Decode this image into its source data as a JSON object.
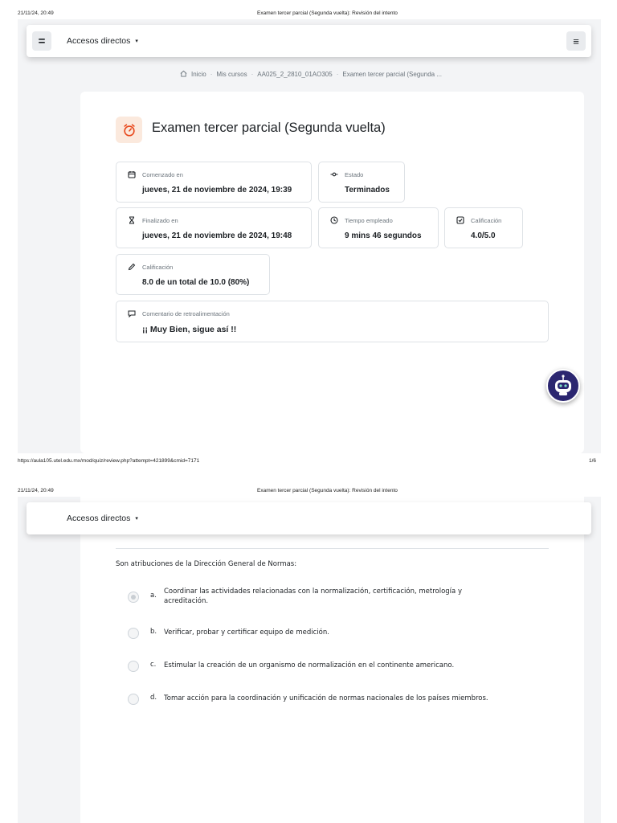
{
  "print": {
    "datetime": "21/11/24, 20:49",
    "doc_title": "Examen tercer parcial (Segunda vuelta): Revisión del intento",
    "url": "https://aula105.utel.edu.mx/mod/quiz/review.php?attempt=421899&cmid=7171",
    "page_num": "1/6"
  },
  "navbar": {
    "menu_glyph": "=",
    "label": "Accesos directos",
    "caret": "▾",
    "right_menu_glyph": "≡"
  },
  "breadcrumb": [
    {
      "label": "Inicio"
    },
    {
      "label": "Mis cursos"
    },
    {
      "label": "AA025_2_2810_01AO305"
    },
    {
      "label": "Examen tercer parcial (Segunda ..."
    }
  ],
  "breadcrumb_sep": "·",
  "page_title": "Examen tercer parcial (Segunda vuelta)",
  "info": {
    "started": {
      "label": "Comenzado en",
      "value": "jueves, 21 de noviembre de 2024, 19:39",
      "icon": "calendar-icon"
    },
    "state": {
      "label": "Estado",
      "value": "Terminados",
      "icon": "state-icon"
    },
    "finished": {
      "label": "Finalizado en",
      "value": "jueves, 21 de noviembre de 2024, 19:48",
      "icon": "hourglass-icon"
    },
    "time_taken": {
      "label": "Tiempo empleado",
      "value": "9 mins 46 segundos",
      "icon": "clock-icon"
    },
    "marks": {
      "label": "Calificación",
      "value": "4.0/5.0",
      "icon": "check-square-icon"
    },
    "grade": {
      "label": "Calificación",
      "value": "8.0 de un total de 10.0 (80%)",
      "icon": "pencil-icon"
    },
    "feedback": {
      "label": "Comentario de retroalimentación",
      "value": "¡¡ Muy Bien, sigue así !!",
      "icon": "comment-icon"
    }
  },
  "question": {
    "text": "Son atribuciones de la Dirección General de Normas:",
    "options": [
      {
        "letter": "a.",
        "text_line1": "Coordinar las actividades relacionadas con la normalización, certificación, metrología y",
        "text_line2": "acreditación.",
        "selected": true
      },
      {
        "letter": "b.",
        "text_line1": "Verificar, probar y certificar equipo de medición.",
        "text_line2": "",
        "selected": false
      },
      {
        "letter": "c.",
        "text_line1": "Estimular la creación de un organismo de normalización en el continente americano.",
        "text_line2": "",
        "selected": false
      },
      {
        "letter": "d.",
        "text_line1": "Tomar acción para la coordinación y unificación de normas nacionales de los países miembros.",
        "text_line2": "",
        "selected": false
      }
    ]
  },
  "colors": {
    "accent_icon": "#e8481c",
    "icon_bg": "#fbe9dd",
    "page_bg": "#f3f4f6",
    "chatbot": "#2b2670"
  }
}
